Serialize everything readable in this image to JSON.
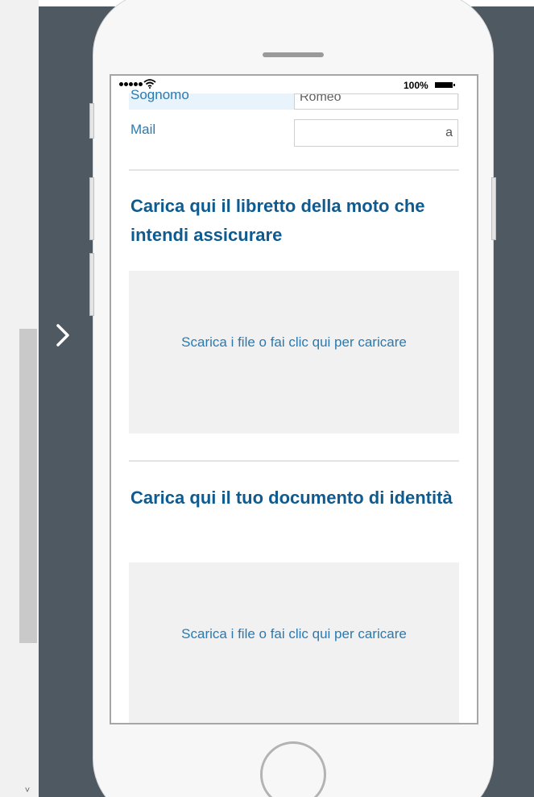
{
  "status_bar": {
    "battery_percent": "100%"
  },
  "form": {
    "surname_label": "Sognomo",
    "surname_value": "Romeo",
    "mail_label": "Mail",
    "mail_value": "a"
  },
  "sections": [
    {
      "title": "Carica qui il libretto della moto che intendi assicurare",
      "dropzone_text": "Scarica i file o fai clic qui per caricare"
    },
    {
      "title": "Carica qui il tuo documento di identità",
      "dropzone_text": "Scarica i file o fai clic qui per caricare"
    }
  ],
  "icons": {
    "nav": "chevron-right-icon",
    "wifi": "wifi-icon",
    "battery": "battery-icon",
    "signal": "signal-icon"
  },
  "colors": {
    "stage": "#4e5962",
    "label": "#2a7ab0",
    "title": "#0f5b8f",
    "dropzone": "#f1f1f1"
  }
}
